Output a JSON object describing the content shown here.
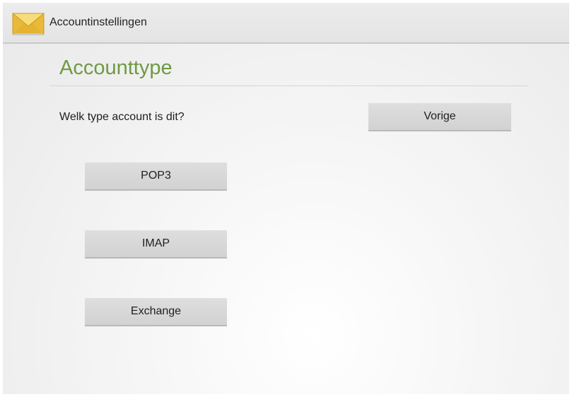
{
  "action_bar": {
    "title": "Accountinstellingen",
    "icon": "mail-envelope-icon"
  },
  "page": {
    "heading": "Accounttype",
    "question": "Welk type account is dit?"
  },
  "buttons": {
    "previous": "Vorige",
    "pop3": "POP3",
    "imap": "IMAP",
    "exchange": "Exchange"
  },
  "colors": {
    "heading": "#6f9a44",
    "envelope": "#f2c94c",
    "button": "#d8d8d8"
  }
}
